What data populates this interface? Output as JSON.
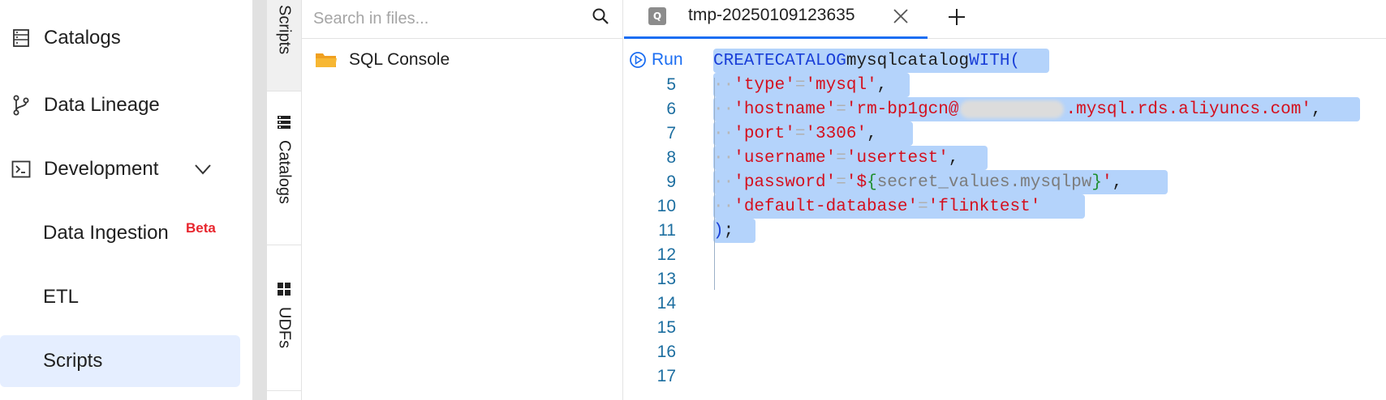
{
  "nav": {
    "items": [
      {
        "label": "Catalogs",
        "icon": "catalog-list-icon"
      },
      {
        "label": "Data Lineage",
        "icon": "branch-icon"
      },
      {
        "label": "Development",
        "icon": "terminal-icon",
        "expanded": true
      }
    ],
    "sub_items": [
      {
        "label": "Data Ingestion",
        "badge": "Beta"
      },
      {
        "label": "ETL"
      },
      {
        "label": "Scripts",
        "active": true
      }
    ]
  },
  "vertical_tabs": [
    {
      "label": "Scripts",
      "active": true
    },
    {
      "label": "Catalogs",
      "icon": "database-icon"
    },
    {
      "label": "UDFs",
      "icon": "grid-icon"
    }
  ],
  "files": {
    "search_placeholder": "Search in files...",
    "items": [
      {
        "label": "SQL Console",
        "icon": "folder-icon"
      }
    ]
  },
  "editor": {
    "tab": {
      "icon_letter": "Q",
      "label": "tmp-20250109123635"
    },
    "run_label": "Run",
    "line_numbers": [
      "5",
      "6",
      "7",
      "8",
      "9",
      "10",
      "11",
      "12",
      "13",
      "14",
      "15",
      "16",
      "17"
    ],
    "code": {
      "l4_kw1": "CREATE",
      "l4_kw2": "CATALOG",
      "l4_name": "mysqlcatalog",
      "l4_kw3": "WITH(",
      "l5_key": "'type'",
      "l5_val": "'mysql'",
      "l6_key": "'hostname'",
      "l6_val_a": "'rm-bp1gcn@",
      "l6_val_b": ".mysql.rds.aliyuncs.com'",
      "l7_key": "'port'",
      "l7_val": "'3306'",
      "l8_key": "'username'",
      "l8_val": "'usertest'",
      "l9_key": "'password'",
      "l9_val_q1": "'$",
      "l9_brace_open": "{",
      "l9_var": "secret_values.mysqlpw",
      "l9_brace_close": "}",
      "l9_val_q2": "'",
      "l10_key": "'default-database'",
      "l10_val": "'flinktest'",
      "l11_close": ")",
      "l11_semi": ";",
      "eq": "=",
      "comma": ",",
      "indent_dots": "··"
    }
  },
  "colors": {
    "accent": "#1c6ef2",
    "selection": "#b4d3fb",
    "active_nav": "#e5eeff",
    "string": "#d4101e",
    "keyword": "#1a3fd8",
    "beta": "#e8262e"
  }
}
